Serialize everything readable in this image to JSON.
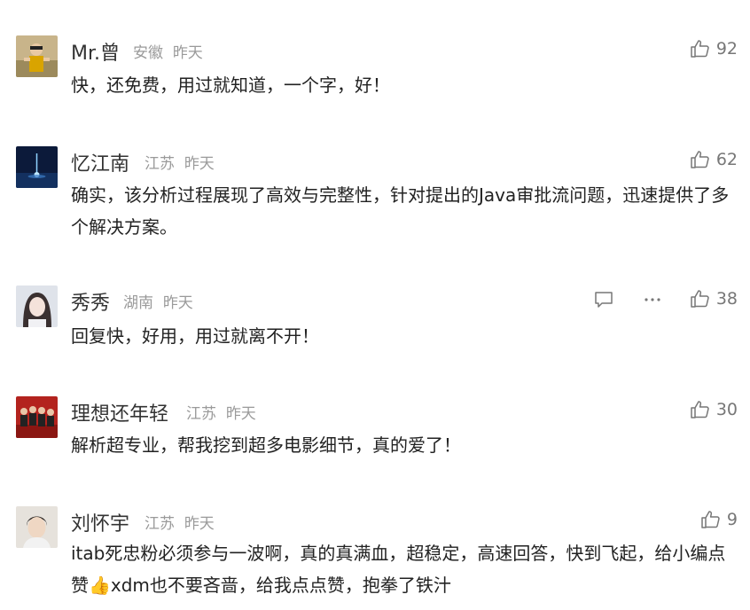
{
  "comments": [
    {
      "name": "Mr.曾",
      "location": "安徽",
      "time": "昨天",
      "likes": "92",
      "text": "快，还免费，用过就知道，一个字，好！"
    },
    {
      "name": "忆江南",
      "location": "江苏",
      "time": "昨天",
      "likes": "62",
      "text": "确实，该分析过程展现了高效与完整性，针对提出的Java审批流问题，迅速提供了多个解决方案。"
    },
    {
      "name": "秀秀",
      "location": "湖南",
      "time": "昨天",
      "likes": "38",
      "text": "回复快，好用，用过就离不开！"
    },
    {
      "name": "理想还年轻",
      "location": "江苏",
      "time": "昨天",
      "likes": "30",
      "text": "解析超专业，帮我挖到超多电影细节，真的爱了！"
    },
    {
      "name": "刘怀宇",
      "location": "江苏",
      "time": "昨天",
      "likes": "9",
      "text": "itab死忠粉必须参与一波啊，真的真满血，超稳定，高速回答，快到飞起，给小编点赞👍xdm也不要吝啬，给我点点赞，抱拳了铁汁"
    }
  ],
  "icons": {
    "like": "thumbs-up-icon",
    "reply": "comment-icon",
    "more": "more-dots-icon"
  }
}
